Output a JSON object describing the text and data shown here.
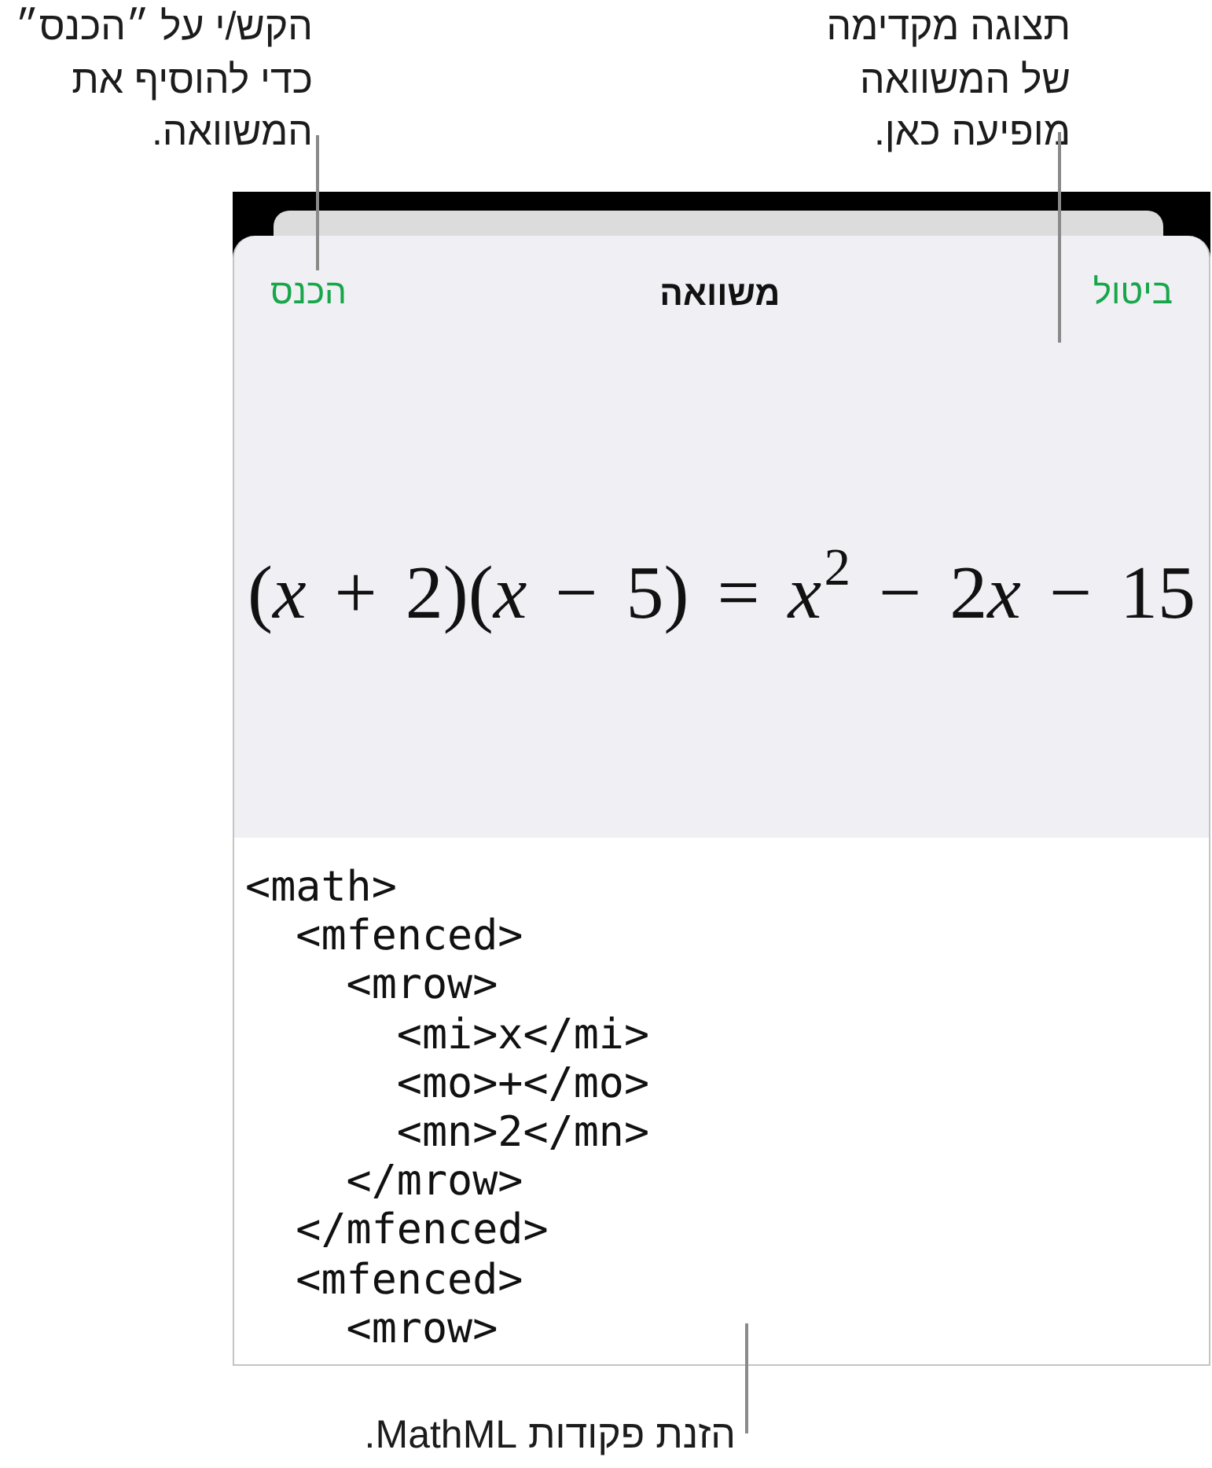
{
  "callouts": {
    "insert_hint": {
      "lines": [
        "הקש/י על ״הכנס״",
        "כדי להוסיף את",
        "המשוואה."
      ]
    },
    "preview_hint": {
      "lines": [
        "תצוגה מקדימה",
        "של המשוואה",
        "מופיעה כאן."
      ]
    },
    "input_hint": {
      "lines": [
        "הזנת פקודות MathML."
      ]
    }
  },
  "dialog": {
    "cancel_button": "ביטול",
    "title": "משוואה",
    "insert_button": "הכנס",
    "preview": "(x + 2)(x − 5) = x$^{2}$ − 2x − 15",
    "mathml_input": {
      "lines": [
        {
          "text": "<math>",
          "children": [
            {
              "text": "<mfenced>",
              "children": [
                {
                  "text": "<mrow>",
                  "children": [
                    {
                      "text": "<mi>x</mi>"
                    },
                    {
                      "text": "<mo>+</mo>"
                    },
                    {
                      "text": "<mn>2</mn>"
                    }
                  ]
                },
                {
                  "text": "</mrow>"
                }
              ]
            },
            {
              "text": "</mfenced>"
            },
            {
              "text": "<mfenced>",
              "children": [
                {
                  "text": "<mrow>"
                }
              ]
            }
          ]
        }
      ]
    }
  }
}
